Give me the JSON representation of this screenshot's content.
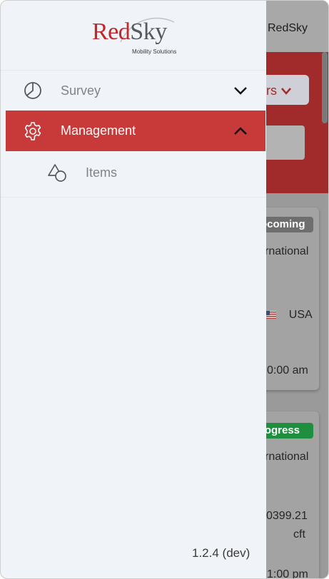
{
  "app": {
    "brand": "RedSky",
    "logo": {
      "word_red": "Red",
      "word_gray": "Sky",
      "tagline": "Mobility Solutions"
    },
    "version": "1.2.4 (dev)"
  },
  "background": {
    "filter_label": "rs",
    "cards": [
      {
        "status": "ocoming",
        "line1": "rnational",
        "country": "USA",
        "time": "0:00 am"
      },
      {
        "status": "rogress",
        "line1": "rnational",
        "volume": "0399.21",
        "unit": "cft",
        "time": "1:00 pm"
      }
    ]
  },
  "nav": {
    "items": [
      {
        "label": "Survey",
        "icon": "pie-chart-icon",
        "expanded": false
      },
      {
        "label": "Management",
        "icon": "gear-icon",
        "expanded": true,
        "active": true
      },
      {
        "label": "Items",
        "icon": "shapes-icon",
        "child": true
      }
    ]
  },
  "colors": {
    "accent": "#c8393a",
    "drawer_bg": "#f0f3f7",
    "badge_progress": "#1e8f3e"
  }
}
